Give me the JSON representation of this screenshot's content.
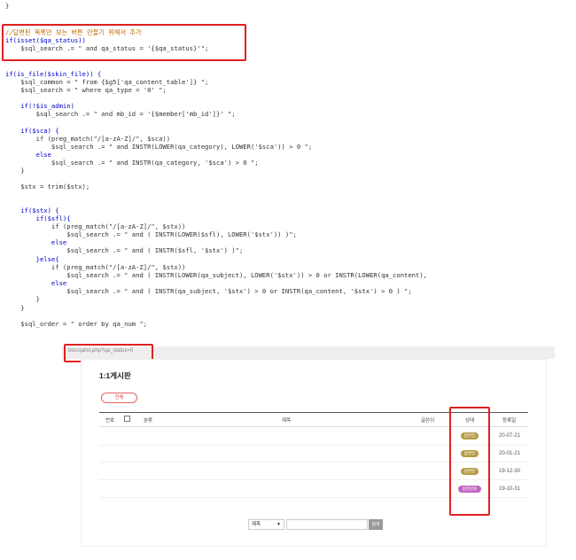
{
  "code": {
    "brace_top": "}",
    "comment": "//답변된 목록만 보는 버튼 만들기 위해서 추가",
    "lines": [
      "if(isset($qa_status))",
      "    $sql_search .= \" and qa_status = '{$qa_status}'\";",
      "if(is_file($skin_file)) {",
      "    $sql_common = \" from {$g5['qa_content_table']} \";",
      "    $sql_search = \" where qa_type = '0' \";",
      "    if(!$is_admin)",
      "        $sql_search .= \" and mb_id = '{$member['mb_id']}' \";",
      "    if($sca) {",
      "        if (preg_match(\"/[a-zA-Z]/\", $sca))",
      "            $sql_search .= \" and INSTR(LOWER(qa_category), LOWER('$sca')) > 0 \";",
      "        else",
      "            $sql_search .= \" and INSTR(qa_category, '$sca') > 0 \";",
      "    }",
      "    $stx = trim($stx);",
      "    if($stx) {",
      "        if($sfl){",
      "            if (preg_match(\"/[a-zA-Z]/\", $stx))",
      "                $sql_search .= \" and ( INSTR(LOWER($sfl), LOWER('$stx')) )\";",
      "            else",
      "                $sql_search .= \" and ( INSTR($sfl, '$stx') )\";",
      "        }else{",
      "            if (preg_match(\"/[a-zA-Z]/\", $stx))",
      "                $sql_search .= \" and ( INSTR(LOWER(qa_subject), LOWER('$stx')) > 0 or INSTR(LOWER(qa_content),",
      "            else",
      "                $sql_search .= \" and ( INSTR(qa_subject, '$stx') > 0 or INSTR(qa_content, '$stx') > 0 ) \";",
      "        }",
      "    }",
      "    $sql_order = \" order by qa_num \";"
    ]
  },
  "browser": {
    "url": "bbs/qalist.php?qa_status=0"
  },
  "board": {
    "title": "1:1게시판",
    "all_button": "전체",
    "headers": {
      "num": "번호",
      "category": "분류",
      "subject": "제목",
      "author": "글쓴이",
      "status": "상태",
      "date": "등록일"
    },
    "rows": [
      {
        "status": "답변전",
        "date": "20-07-21"
      },
      {
        "status": "답변전",
        "date": "20-01-21"
      },
      {
        "status": "답변전",
        "date": "19-12-30"
      },
      {
        "status": "답변완료",
        "date": "19-10-31"
      }
    ],
    "search": {
      "select_value": "제목",
      "button": "검색"
    }
  },
  "colors": {
    "highlight": "#e02020",
    "badge_pending": "#b79b45",
    "badge_done": "#c266c2"
  }
}
